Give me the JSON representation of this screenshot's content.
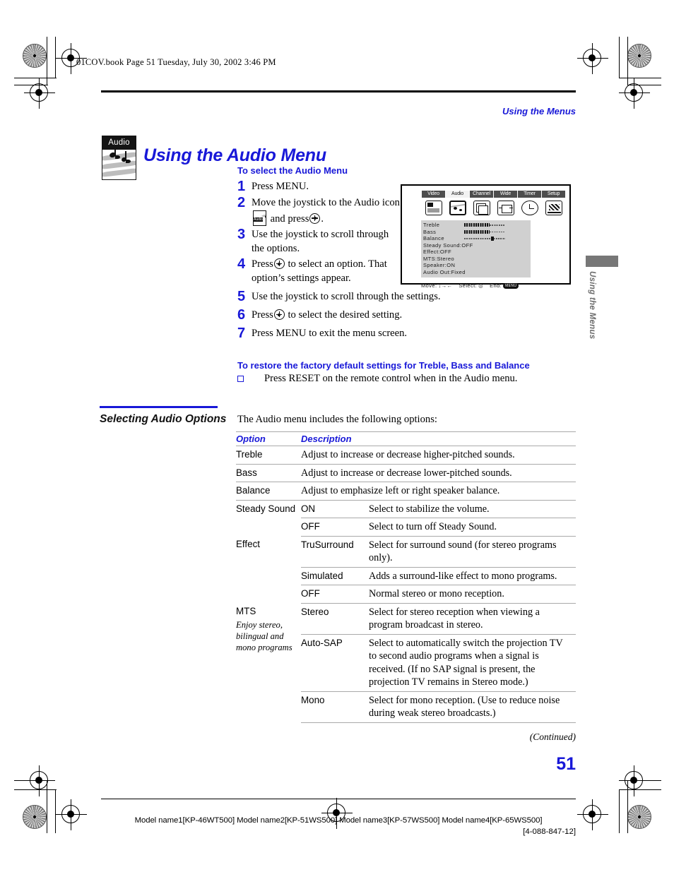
{
  "header": {
    "book_line": "01COV.book  Page 51  Tuesday, July 30, 2002  3:46 PM",
    "running_head": "Using the Menus"
  },
  "side_tab": {
    "label": "Using the Menus"
  },
  "chapter_icon": {
    "caption": "Audio"
  },
  "title": "Using the Audio Menu",
  "procedure": {
    "heading": "To select the Audio Menu",
    "steps": [
      {
        "num": "1",
        "text_before": "Press MENU.",
        "text_after": ""
      },
      {
        "num": "2",
        "text_before": "Move the joystick to the Audio icon",
        "text_after": "and press",
        "text_end": "."
      },
      {
        "num": "3",
        "text_before": "Use the joystick to scroll through the options.",
        "text_after": ""
      },
      {
        "num": "4",
        "text_before": "Press",
        "text_after": "to select an option. That option’s settings appear.",
        "text_end": ""
      },
      {
        "num": "5",
        "text_before": "Use the joystick to scroll through the settings.",
        "text_after": ""
      },
      {
        "num": "6",
        "text_before": "Press",
        "text_after": "to select the desired setting.",
        "text_end": ""
      },
      {
        "num": "7",
        "text_before": "Press MENU to exit the menu screen.",
        "text_after": ""
      }
    ]
  },
  "tv_screen": {
    "tabs": [
      {
        "label": "Video",
        "active": false
      },
      {
        "label": "Audio",
        "active": true
      },
      {
        "label": "Channel",
        "active": false
      },
      {
        "label": "Wide",
        "active": false
      },
      {
        "label": "Timer",
        "active": false
      },
      {
        "label": "Setup",
        "active": false
      }
    ],
    "items": [
      {
        "label": "Treble",
        "type": "bar",
        "value": 58
      },
      {
        "label": "Bass",
        "type": "bar",
        "value": 58
      },
      {
        "label": "Balance",
        "type": "bar",
        "value": 0
      },
      {
        "label": "Steady Sound:OFF",
        "type": "text"
      },
      {
        "label": "Effect:OFF",
        "type": "text"
      },
      {
        "label": "MTS:Stereo",
        "type": "text"
      },
      {
        "label": "Speaker:ON",
        "type": "text"
      },
      {
        "label": "Audio Out:Fixed",
        "type": "text"
      }
    ],
    "bottom": {
      "move_label": "Move:",
      "move_glyphs": "↓→←",
      "select_label": "Select:",
      "end_label": "End:",
      "end_glyph": "MENU"
    }
  },
  "restore": {
    "heading": "To restore the factory default settings for Treble, Bass and Balance",
    "bullet_text": "Press RESET on the remote control when in the Audio menu."
  },
  "section": {
    "side_heading": "Selecting Audio Options",
    "lead_in": "The Audio menu includes the following options:"
  },
  "table": {
    "headers": {
      "option": "Option",
      "description": "Description"
    },
    "rows": [
      {
        "option": "Treble",
        "value": "",
        "description": "Adjust to increase or decrease higher-pitched sounds."
      },
      {
        "option": "Bass",
        "value": "",
        "description": "Adjust to increase or decrease lower-pitched sounds."
      },
      {
        "option": "Balance",
        "value": "",
        "description": "Adjust to emphasize left or right speaker balance."
      },
      {
        "option": "Steady Sound",
        "value": "ON",
        "description": "Select to stabilize the volume."
      },
      {
        "option": "",
        "value": "OFF",
        "description": "Select to turn off Steady Sound."
      },
      {
        "option": "Effect",
        "value": "TruSurround",
        "description": "Select for surround sound (for stereo programs only)."
      },
      {
        "option": "",
        "value": "Simulated",
        "description": "Adds a surround-like effect to mono programs."
      },
      {
        "option": "",
        "value": "OFF",
        "description": "Normal stereo or mono reception."
      },
      {
        "option": "MTS",
        "option_note": "Enjoy stereo, bilingual and mono programs",
        "value": "Stereo",
        "description": "Select for stereo reception when viewing a program broadcast in stereo."
      },
      {
        "option": "",
        "value": "Auto-SAP",
        "description": "Select to automatically switch the projection TV to second audio programs when a signal is received. (If no SAP signal is present, the projection TV remains in Stereo mode.)"
      },
      {
        "option": "",
        "value": "Mono",
        "description": "Select for mono reception. (Use to reduce noise during weak stereo broadcasts.)"
      }
    ]
  },
  "footer": {
    "continued": "(Continued)",
    "page_number": "51",
    "models": "Model name1[KP-46WT500] Model name2[KP-51WS500] Model name3[KP-57WS500] Model name4[KP-65WS500]",
    "doc_code": "[4-088-847-12]"
  },
  "colors": {
    "accent_blue": "#1818d8",
    "rule_gray": "#a9a9a9",
    "tab_gray": "#6d6d6d"
  }
}
